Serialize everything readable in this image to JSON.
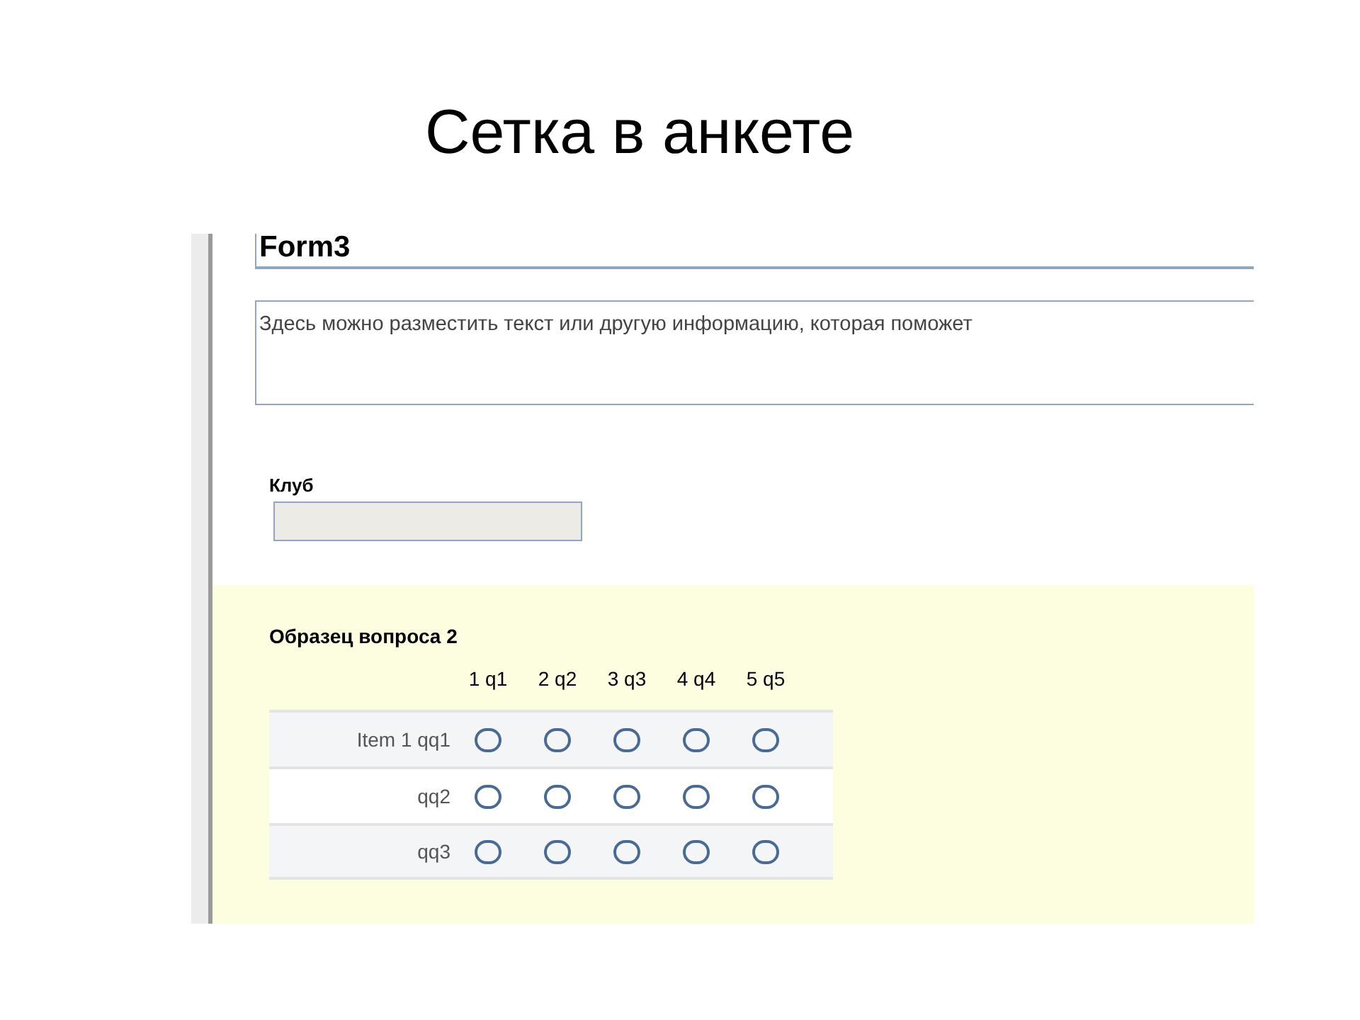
{
  "slide_title": "Сетка в анкете",
  "form": {
    "title": "Form3",
    "description": "Здесь можно разместить текст или другую информацию, которая поможет",
    "fields": [
      {
        "label": "Клуб"
      }
    ],
    "question": {
      "title": "Образец вопроса 2",
      "columns": [
        "1 q1",
        "2 q2",
        "3 q3",
        "4 q4",
        "5 q5"
      ],
      "rows": [
        {
          "label": "Item 1 qq1",
          "options": [
            {
              "selected": false
            },
            {
              "selected": false
            },
            {
              "selected": false
            },
            {
              "selected": false
            },
            {
              "selected": false
            }
          ]
        },
        {
          "label": "qq2",
          "options": [
            {
              "selected": false
            },
            {
              "selected": false
            },
            {
              "selected": false
            },
            {
              "selected": false
            },
            {
              "selected": false
            }
          ]
        },
        {
          "label": "qq3",
          "options": [
            {
              "selected": false
            },
            {
              "selected": false
            },
            {
              "selected": false
            },
            {
              "selected": false
            },
            {
              "selected": false
            }
          ]
        }
      ]
    }
  }
}
